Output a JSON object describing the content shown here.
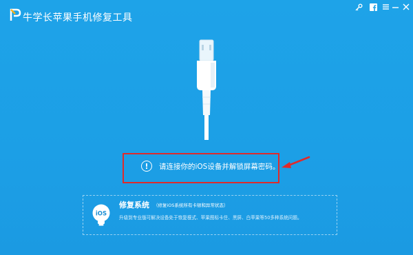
{
  "app": {
    "title": "牛学长苹果手机修复工具"
  },
  "titlebar_icons": [
    "key-icon",
    "facebook-icon",
    "menu-icon",
    "minimize-icon",
    "close-icon"
  ],
  "main": {
    "prompt_text": "请连接你的iOS设备并解锁屏幕密码。",
    "alert_glyph": "!"
  },
  "repair": {
    "title": "修复系统",
    "note": "（修复iOS系统所有卡顿和异常状态）",
    "description": "升级到专业版可解决设备处于恢复模式、苹果图标卡住、黑屏、白苹果等50多种系统问题。",
    "badge_text": "iOS"
  },
  "colors": {
    "background": "#1ea3e8",
    "highlight_border": "#e02a2a",
    "text": "#ffffff"
  }
}
